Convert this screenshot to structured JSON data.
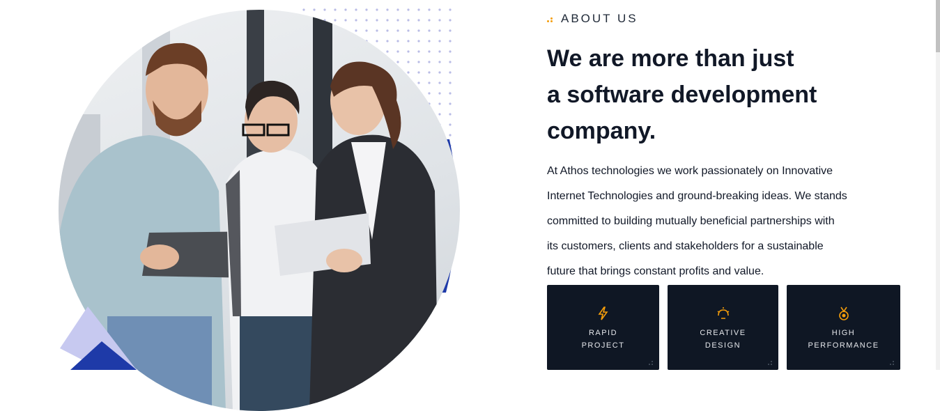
{
  "about": {
    "eyebrow": "ABOUT US",
    "headline": [
      "We are more than just",
      "a software development",
      "company."
    ],
    "paragraph": [
      "At Athos technologies we work passionately on Innovative",
      "Internet Technologies and ground-breaking ideas. We stands",
      "committed to building mutually beneficial partnerships with",
      "its customers, clients and stakeholders for a sustainable",
      "future that brings constant profits and value."
    ]
  },
  "cards": [
    {
      "icon": "lightning-icon",
      "label": [
        "RAPID",
        "PROJECT"
      ]
    },
    {
      "icon": "creative-icon",
      "label": [
        "CREATIVE",
        "DESIGN"
      ]
    },
    {
      "icon": "medal-icon",
      "label": [
        "HIGH",
        "PERFORMANCE"
      ]
    }
  ],
  "colors": {
    "accent": "#f59e0b",
    "card_bg": "#0f1724",
    "brand_blue": "#1e3aa8",
    "lavender": "#c7c9f0"
  }
}
